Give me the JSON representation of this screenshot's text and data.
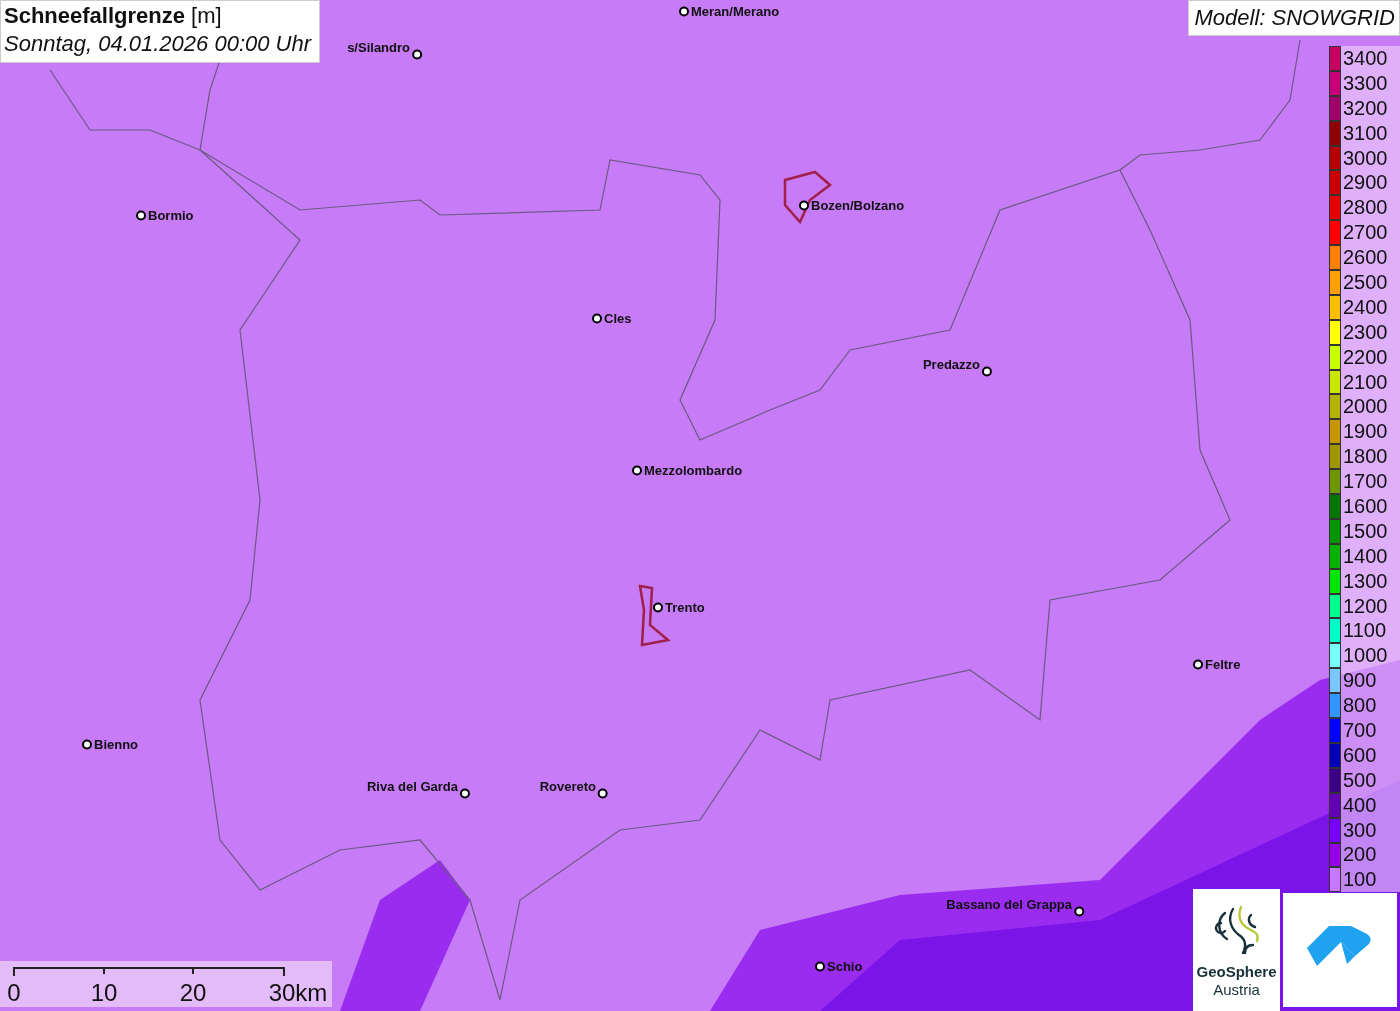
{
  "title": {
    "name": "Schneefallgrenze",
    "unit": "[m]",
    "date": "Sonntag, 04.01.2026 00:00 Uhr"
  },
  "model": "Modell: SNOWGRID",
  "places": [
    {
      "name": "Meran/Merano",
      "label_left": false
    },
    {
      "name": "s/Silandro",
      "label_left": true
    },
    {
      "name": "Bormio",
      "label_left": false
    },
    {
      "name": "Bozen/Bolzano",
      "label_left": false
    },
    {
      "name": "Cles",
      "label_left": false
    },
    {
      "name": "Predazzo",
      "label_left": true
    },
    {
      "name": "Mezzolombardo",
      "label_left": false
    },
    {
      "name": "Trento",
      "label_left": false
    },
    {
      "name": "Feltre",
      "label_left": false
    },
    {
      "name": "Bienno",
      "label_left": false
    },
    {
      "name": "Riva del Garda",
      "label_left": true
    },
    {
      "name": "Rovereto",
      "label_left": true
    },
    {
      "name": "Bassano del Grappa",
      "label_left": true
    },
    {
      "name": "Schio",
      "label_left": false
    }
  ],
  "legend": [
    {
      "label": "3400",
      "color": "#c80064"
    },
    {
      "label": "3300",
      "color": "#c8007a"
    },
    {
      "label": "3200",
      "color": "#a0006e"
    },
    {
      "label": "3100",
      "color": "#8c0000"
    },
    {
      "label": "3000",
      "color": "#b40000"
    },
    {
      "label": "2900",
      "color": "#c80000"
    },
    {
      "label": "2800",
      "color": "#e60000"
    },
    {
      "label": "2700",
      "color": "#ff0000"
    },
    {
      "label": "2600",
      "color": "#ff8000"
    },
    {
      "label": "2500",
      "color": "#ffa000"
    },
    {
      "label": "2400",
      "color": "#ffbe00"
    },
    {
      "label": "2300",
      "color": "#ffff00"
    },
    {
      "label": "2200",
      "color": "#c8ff00"
    },
    {
      "label": "2100",
      "color": "#c8e600"
    },
    {
      "label": "2000",
      "color": "#b4b400"
    },
    {
      "label": "1900",
      "color": "#c89600"
    },
    {
      "label": "1800",
      "color": "#a09600"
    },
    {
      "label": "1700",
      "color": "#6e9600"
    },
    {
      "label": "1600",
      "color": "#007800"
    },
    {
      "label": "1500",
      "color": "#009600"
    },
    {
      "label": "1400",
      "color": "#00b400"
    },
    {
      "label": "1300",
      "color": "#00e600"
    },
    {
      "label": "1200",
      "color": "#00ff8c"
    },
    {
      "label": "1100",
      "color": "#00ffc8"
    },
    {
      "label": "1000",
      "color": "#78ffff"
    },
    {
      "label": "900",
      "color": "#78c8ff"
    },
    {
      "label": "800",
      "color": "#3296ff"
    },
    {
      "label": "700",
      "color": "#0000ff"
    },
    {
      "label": "600",
      "color": "#0000b4"
    },
    {
      "label": "500",
      "color": "#3c0082"
    },
    {
      "label": "400",
      "color": "#6400b4"
    },
    {
      "label": "300",
      "color": "#7800ff"
    },
    {
      "label": "200",
      "color": "#9600e6"
    },
    {
      "label": "100",
      "color": "#c878ff"
    }
  ],
  "scale": [
    "0",
    "10",
    "20",
    "30km"
  ],
  "logo": {
    "line1": "GeoSphere",
    "line2": "Austria"
  }
}
